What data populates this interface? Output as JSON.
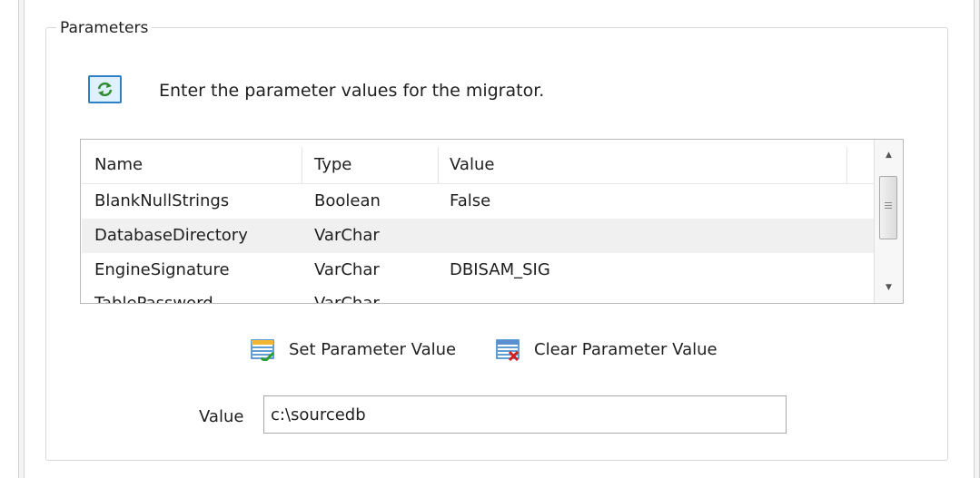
{
  "group": {
    "title": "Parameters"
  },
  "header": {
    "icon": "refresh-icon",
    "text": "Enter the parameter values for the migrator."
  },
  "grid": {
    "columns": [
      "Name",
      "Type",
      "Value"
    ],
    "rows": [
      {
        "name": "BlankNullStrings",
        "type": "Boolean",
        "value": "False"
      },
      {
        "name": "DatabaseDirectory",
        "type": "VarChar",
        "value": ""
      },
      {
        "name": "EngineSignature",
        "type": "VarChar",
        "value": "DBISAM_SIG"
      },
      {
        "name": "TablePassword",
        "type": "VarChar",
        "value": ""
      }
    ],
    "selected_row": "DatabaseDirectory"
  },
  "actions": {
    "set_label": "Set Parameter Value",
    "clear_label": "Clear Parameter Value"
  },
  "value_field": {
    "label": "Value",
    "value": "c:\\sourcedb"
  },
  "colors": {
    "accent": "#2f7fc5",
    "selected_row": "#f0f0f0",
    "border": "#b9b9b9"
  }
}
